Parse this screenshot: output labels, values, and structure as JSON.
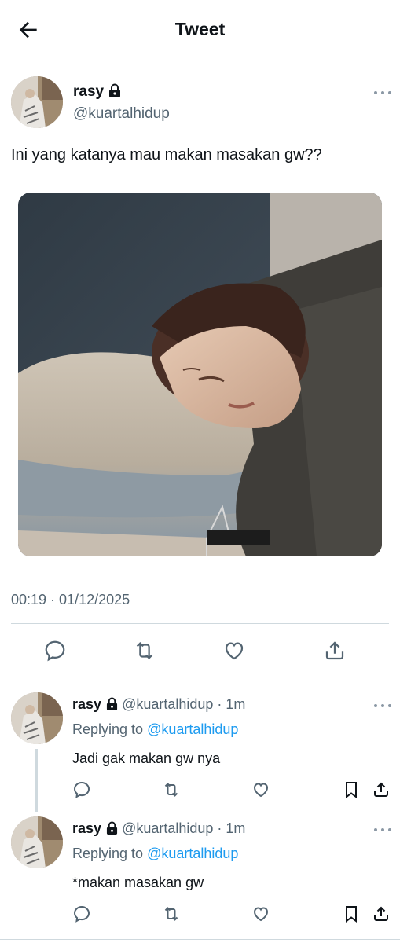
{
  "header": {
    "title": "Tweet",
    "back_icon": "arrow-left-icon"
  },
  "tweet": {
    "author_name": "rasy",
    "author_handle": "@kuartalhidup",
    "protected_icon": "lock-icon",
    "text": "Ini yang katanya mau makan masakan gw??",
    "timestamp": "00:19 · 01/12/2025",
    "actions": [
      "reply-icon",
      "retweet-icon",
      "like-icon",
      "share-icon"
    ]
  },
  "replies": [
    {
      "author_name": "rasy",
      "author_handle": "@kuartalhidup",
      "time": "· 1m",
      "replying_prefix": "Replying to",
      "replying_to": "@kuartalhidup",
      "text": "Jadi gak makan gw nya"
    },
    {
      "author_name": "rasy",
      "author_handle": "@kuartalhidup",
      "time": "· 1m",
      "replying_prefix": "Replying to",
      "replying_to": "@kuartalhidup",
      "text": "*makan masakan gw"
    }
  ],
  "colors": {
    "text": "#0f1419",
    "secondary": "#536471",
    "link": "#1d9bf0",
    "divider": "#cfd9de"
  }
}
